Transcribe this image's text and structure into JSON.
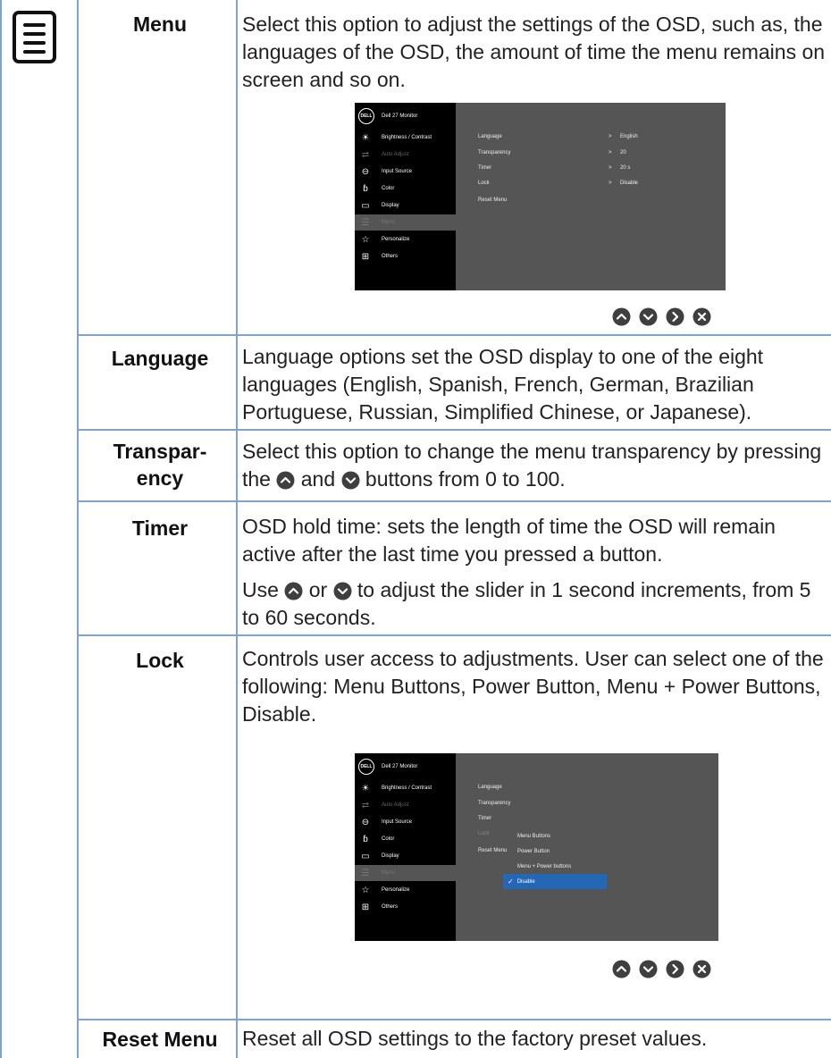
{
  "rows": {
    "menu": {
      "label": "Menu",
      "desc": "Select this option to adjust the settings of the OSD, such as, the languages of the OSD, the amount of time the menu remains on screen and so on."
    },
    "language": {
      "label": "Language",
      "desc": "Language options set the OSD display to one of the eight languages (English, Spanish, French, German, Brazilian Portuguese, Russian, Simplified Chinese, or Japanese)."
    },
    "transparency": {
      "label_1": "Transpar-",
      "label_2": "ency",
      "desc_a": "Select this option to change the menu transparency by pressing the",
      "desc_b": "and",
      "desc_c": "buttons from 0 to 100."
    },
    "timer": {
      "label": "Timer",
      "desc1": "OSD hold time: sets the length of time the OSD will remain active after the last time you pressed a button.",
      "desc2_a": "Use",
      "desc2_b": "or",
      "desc2_c": "to adjust the slider in 1 second increments, from 5 to 60 seconds."
    },
    "lock": {
      "label": "Lock",
      "desc": "Controls user access to adjustments. User can select one of the following: Menu Buttons, Power Button, Menu + Power Buttons, Disable."
    },
    "reset": {
      "label": "Reset Menu",
      "desc": "Reset all OSD settings to the factory preset values."
    }
  },
  "osd": {
    "logo": "DELL",
    "title": "Dell 27 Monitor",
    "menu_items": [
      {
        "label": "Brightness / Contrast",
        "icon": "brightness-icon"
      },
      {
        "label": "Auto Adjust",
        "icon": "auto-adjust-icon"
      },
      {
        "label": "Input Source",
        "icon": "input-source-icon"
      },
      {
        "label": "Color",
        "icon": "color-icon"
      },
      {
        "label": "Display",
        "icon": "display-icon"
      },
      {
        "label": "Menu",
        "icon": "menu-icon"
      },
      {
        "label": "Personalize",
        "icon": "star-icon"
      },
      {
        "label": "Others",
        "icon": "others-icon"
      }
    ],
    "options": [
      "Language",
      "Transparency",
      "Timer",
      "Lock",
      "Reset Menu"
    ],
    "values": [
      "English",
      "20",
      "20 s",
      "Disable"
    ],
    "arrow": ">",
    "lock_options": [
      "Menu Buttons",
      "Power Button",
      "Menu + Power buttons",
      "Disable"
    ],
    "check": "✓"
  },
  "colors": {
    "border": "#7fa3d1",
    "button": "#3f3f3f",
    "highlight": "#2468b5"
  }
}
